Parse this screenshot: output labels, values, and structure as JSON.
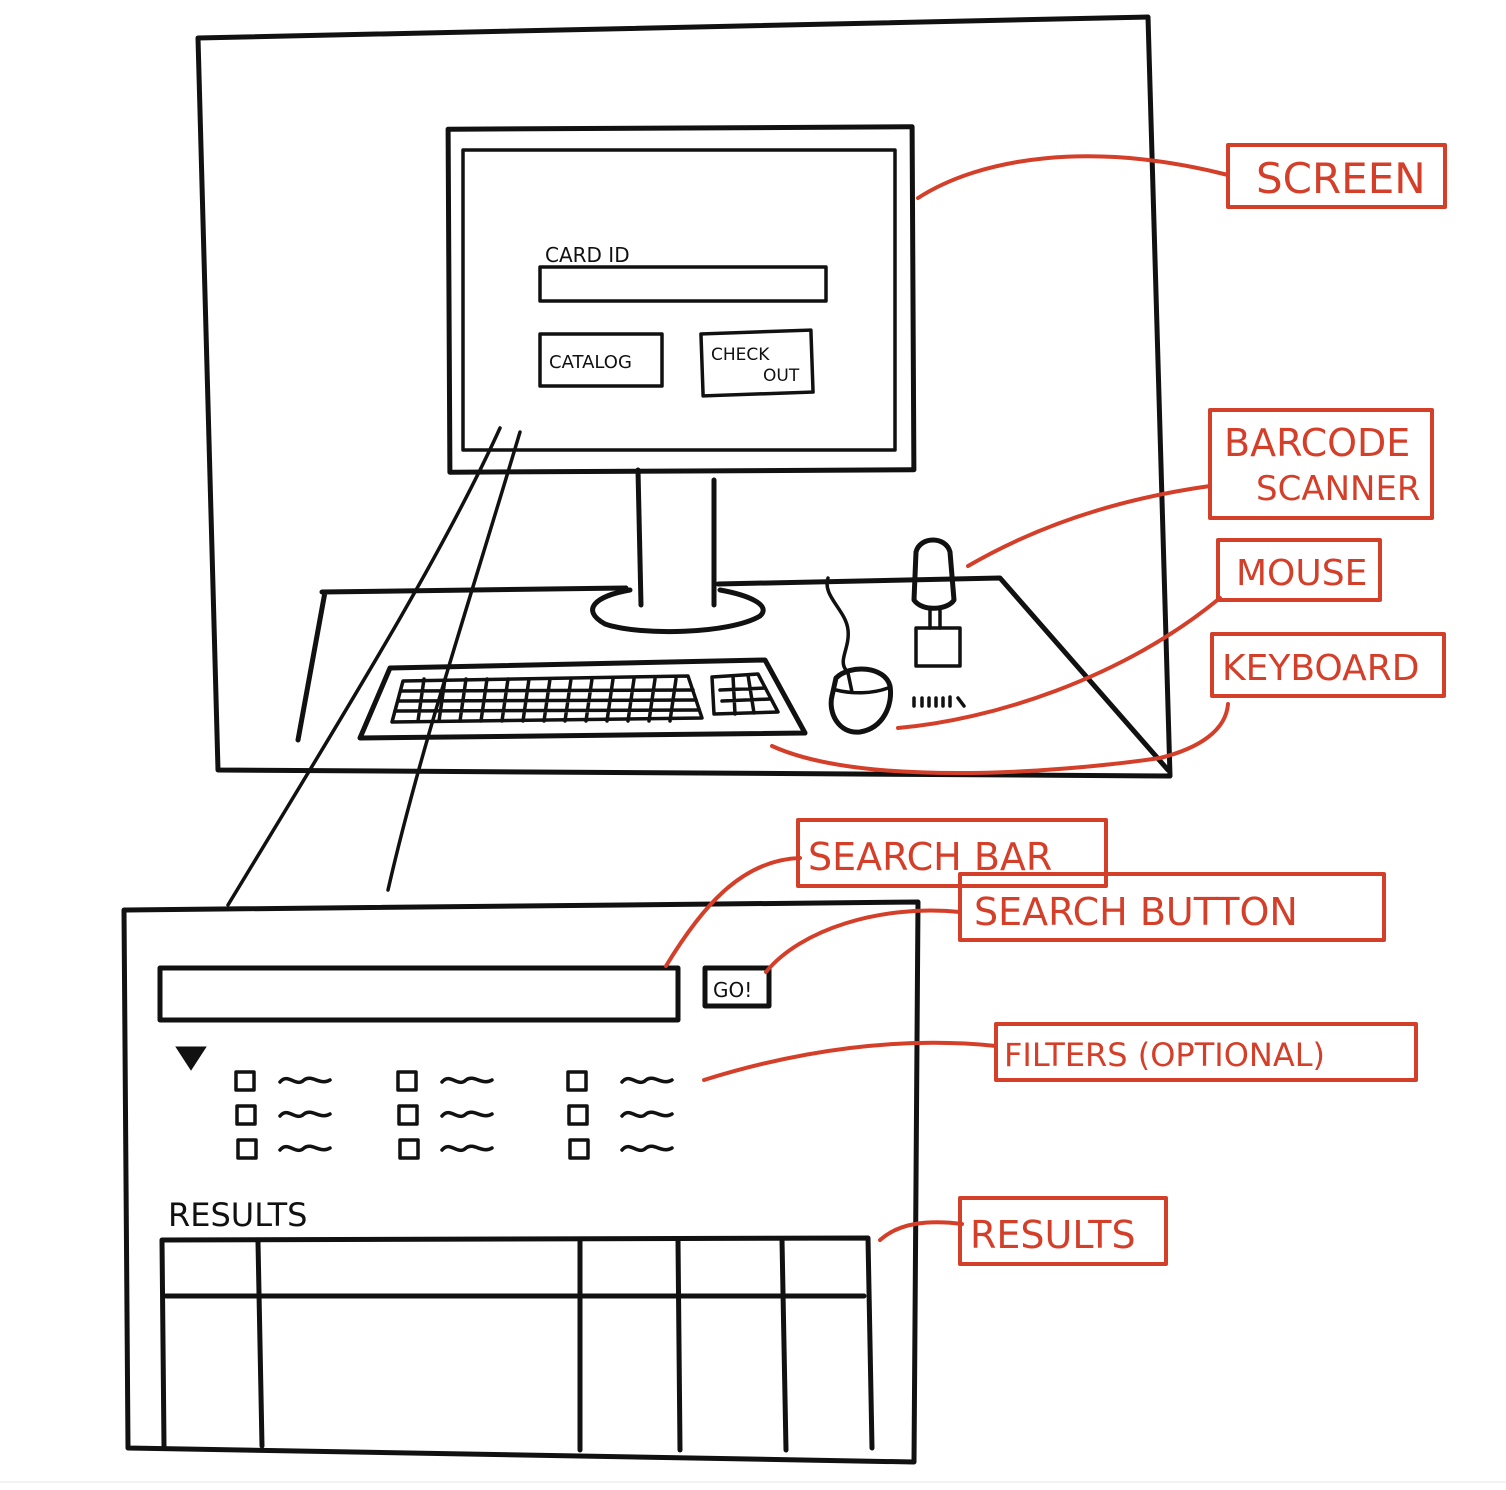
{
  "kiosk_screen": {
    "card_id_label": "CARD ID",
    "catalog_button": "CATALOG",
    "checkout_button_line1": "CHECK",
    "checkout_button_line2": "OUT"
  },
  "search_screen": {
    "go_button": "GO!",
    "results_heading": "RESULTS"
  },
  "callouts": {
    "screen": "SCREEN",
    "barcode_scanner_line1": "BARCODE",
    "barcode_scanner_line2": "SCANNER",
    "mouse": "MOUSE",
    "keyboard": "KEYBOARD",
    "search_bar": "SEARCH BAR",
    "search_button": "SEARCH BUTTON",
    "filters": "FILTERS (OPTIONAL)",
    "results": "RESULTS"
  },
  "colors": {
    "ink": "#111111",
    "annotation_red": "#d43f2a",
    "background": "#ffffff"
  },
  "icons": {
    "filters_toggle": "triangle-down-icon",
    "filter_checkbox": "checkbox-icon"
  }
}
